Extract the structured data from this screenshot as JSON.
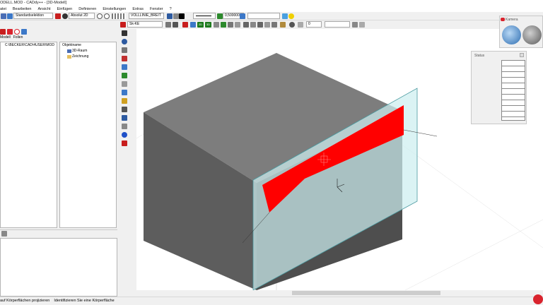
{
  "window": {
    "title": "ODELL.MOD - CADdy++ - [3D-Modell]"
  },
  "menu": [
    "atei",
    "Bearbeiten",
    "Ansicht",
    "Einfügen",
    "Definieren",
    "Einstellungen",
    "Extras",
    "Fenster",
    "?"
  ],
  "toolbar1": {
    "selection_mode": "Standardselektion",
    "coord_mode": "Absolut 2D",
    "linetype": "VOLLLINIE_BREIT",
    "linewidth": "0,500000",
    "blank_field": ""
  },
  "toolbar2": {
    "view_name": "Sk-KE",
    "icon_label_20_a": "2D",
    "icon_label_20_b": "3D",
    "step_value": "0",
    "blank_field": ""
  },
  "left_panel": {
    "tab_model": "Modell",
    "tab_folder": "Folien",
    "tree_path": "C:\\BECKER\\CAD\\4USER\\MOD",
    "object_header": "Objektname",
    "objects": [
      "3D-Raum",
      "Zeichnung"
    ]
  },
  "kamera": {
    "title": "Kamera"
  },
  "status_panel": {
    "title": "Status"
  },
  "statusbar": {
    "left": "auf Körperflächen projizieren",
    "right": "Identifizieren Sie eine Körperfläche"
  },
  "colors": {
    "box_top": "#7d7d7d",
    "box_front": "#5d5d5d",
    "box_side": "#4e4e4e",
    "plane": "#cdeff0",
    "section_cut": "#ff0000"
  }
}
